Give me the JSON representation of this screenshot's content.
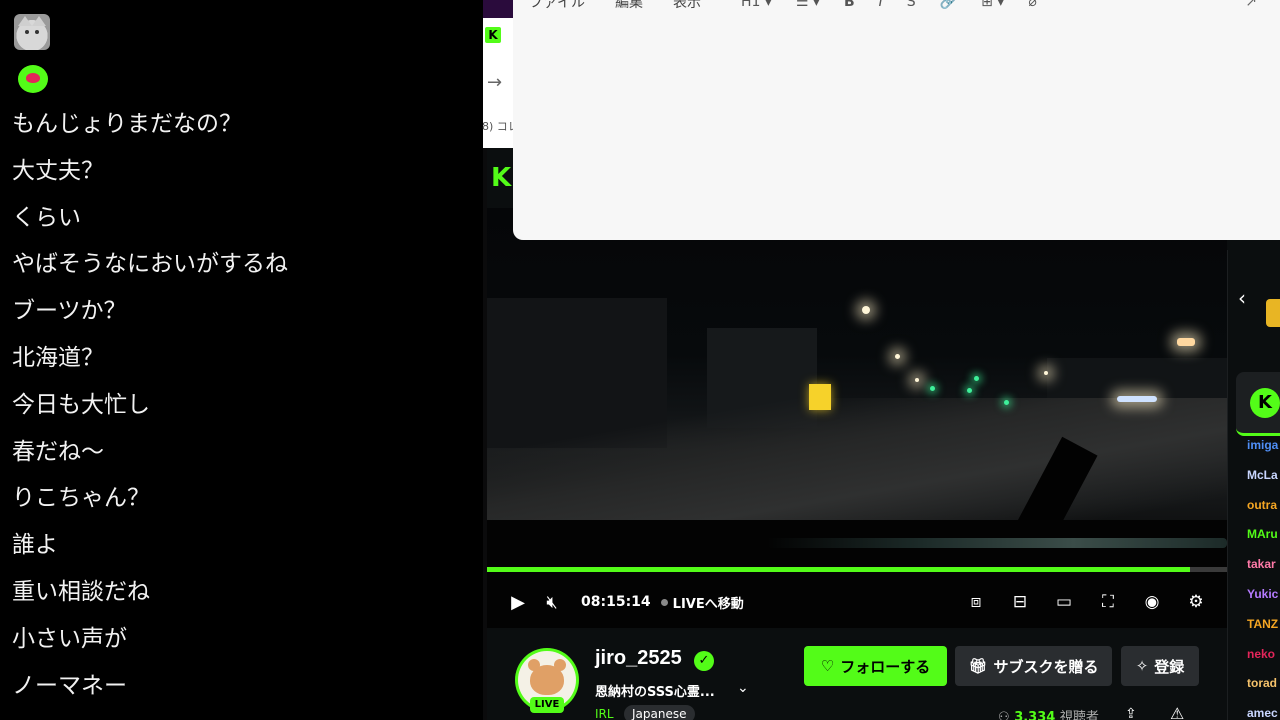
{
  "left_chat": {
    "messages": [
      "もんじょりまだなの？",
      "大丈夫？",
      "くらい",
      "やばそうなにおいがするね",
      "ブーツか？",
      "北海道？",
      "今日も大忙し",
      "春だね〜",
      "りこちゃん？",
      "誰よ",
      "重い相談だね",
      "小さい声が",
      "ノーマネー"
    ]
  },
  "browser": {
    "favicon_letter": "K",
    "bookmark_fragment": "8) コレ"
  },
  "editor": {
    "menu": [
      "ファイル",
      "編集",
      "表示"
    ],
    "tools": [
      "H1 ▾",
      "☰ ▾",
      "B",
      "I",
      "S",
      "🔗",
      "⊞ ▾",
      "⌀"
    ],
    "share_icon": "↗"
  },
  "site": {
    "logo_letter": "K"
  },
  "player": {
    "time": "08:15:14",
    "live_jump": "LIVEへ移動",
    "progress": 0.95,
    "icons": [
      "play-icon",
      "mute-icon",
      "miniplayer-icon",
      "pip-icon",
      "theater-icon",
      "fullscreen-icon",
      "clip-icon",
      "settings-icon"
    ]
  },
  "channel": {
    "name": "jiro_2525",
    "live_badge": "LIVE",
    "title": "恩納村のSSS心霊...",
    "category": "IRL",
    "language": "Japanese",
    "viewer_count": "3,334",
    "viewer_label": "視聴者"
  },
  "buttons": {
    "follow": "フォローする",
    "gift": "サブスクを贈る",
    "subscribe": "登録"
  },
  "right_chat": {
    "pinned_letter": "K",
    "users": [
      {
        "name": "imiga",
        "color": "#4f8ff7"
      },
      {
        "name": "McLa",
        "color": "#c9d6ff"
      },
      {
        "name": "outra",
        "color": "#f5a623"
      },
      {
        "name": "MAru",
        "color": "#53fc18"
      },
      {
        "name": "takar",
        "color": "#ff7aa8"
      },
      {
        "name": "Yukic",
        "color": "#b57bff"
      },
      {
        "name": "TANZ",
        "color": "#f5a623"
      },
      {
        "name": "neko",
        "color": "#e3255a"
      },
      {
        "name": "torad",
        "color": "#f5c26b"
      },
      {
        "name": "amec",
        "color": "#c9d6ff"
      }
    ]
  }
}
